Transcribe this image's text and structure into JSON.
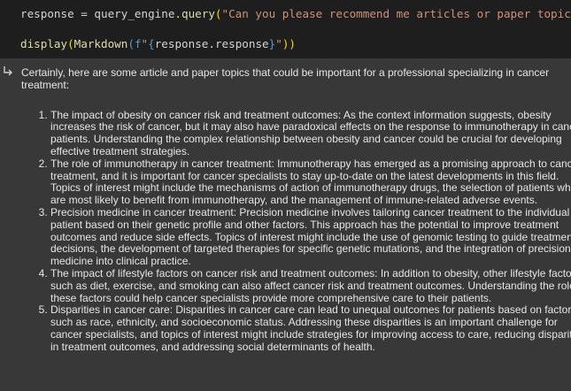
{
  "code_cell": {
    "line1": {
      "var": "response",
      "op": " = ",
      "obj": "query_engine.",
      "fn": "query",
      "open": "(",
      "string": "\"Can you please recommend me articles or paper topics t"
    },
    "line2": {
      "fn": "display",
      "open": "(",
      "fn2": "Markdown",
      "open2": "(",
      "prefix": "f",
      "str_open": "\"",
      "brace_open": "{",
      "expr": "response.response",
      "brace_close": "}",
      "str_close": "\"",
      "close": "))"
    }
  },
  "output": {
    "intro": "Certainly, here are some article and paper topics that could be important for a professional specializing in cancer treatment:",
    "items": [
      "The impact of obesity on cancer risk and treatment outcomes: As the context information suggests, obesity increases the risk of cancer, but it may also have paradoxical effects on the response to immunotherapy in cancer patients. Understanding the complex relationship between obesity and cancer could be crucial for developing effective treatment strategies.",
      "The role of immunotherapy in cancer treatment: Immunotherapy has emerged as a promising approach to cancer treatment, and it is important for cancer specialists to stay up-to-date on the latest developments in this field. Topics of interest might include the mechanisms of action of immunotherapy drugs, the selection of patients who are most likely to benefit from immunotherapy, and the management of immune-related adverse events.",
      "Precision medicine in cancer treatment: Precision medicine involves tailoring cancer treatment to the individual patient based on their genetic profile and other factors. This approach has the potential to improve treatment outcomes and reduce side effects. Topics of interest might include the use of genomic testing to guide treatment decisions, the development of targeted therapies for specific genetic mutations, and the integration of precision medicine into clinical practice.",
      "The impact of lifestyle factors on cancer risk and treatment outcomes: In addition to obesity, other lifestyle factors such as diet, exercise, and smoking can also affect cancer risk and treatment outcomes. Understanding the role of these factors could help cancer specialists provide more comprehensive care to their patients.",
      "Disparities in cancer care: Disparities in cancer care can lead to unequal outcomes for patients based on factors such as race, ethnicity, and socioeconomic status. Addressing these disparities is an important challenge for cancer specialists, and topics of interest might include strategies for improving access to care, reducing disparities in treatment outcomes, and addressing social determinants of health."
    ]
  },
  "icons": {
    "output_icon": "output-arrow-icon"
  },
  "colors": {
    "code_bg": "#1e1e1e",
    "output_bg": "#383838",
    "string": "#ce9178",
    "function": "#dcdcaa",
    "keyword_blue": "#569cd6",
    "bracket_gold": "#ffd700"
  }
}
